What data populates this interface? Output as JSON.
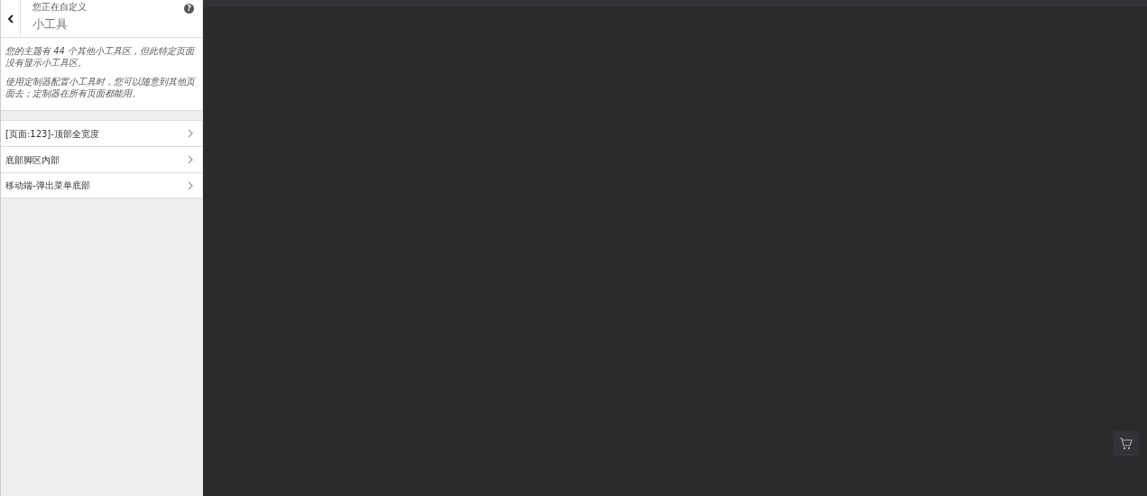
{
  "header": {
    "preface": "您正在自定义",
    "title": "小工具",
    "help": "?"
  },
  "notices": [
    "您的主题有 44 个其他小工具区，但此特定页面没有显示小工具区。",
    "使用定制器配置小工具时，您可以随意到其他页面去；定制器在所有页面都能用。"
  ],
  "sections": [
    {
      "label": "[页面:123]-顶部全宽度"
    },
    {
      "label": "底部脚区内部"
    },
    {
      "label": "移动端-弹出菜单底部"
    }
  ]
}
